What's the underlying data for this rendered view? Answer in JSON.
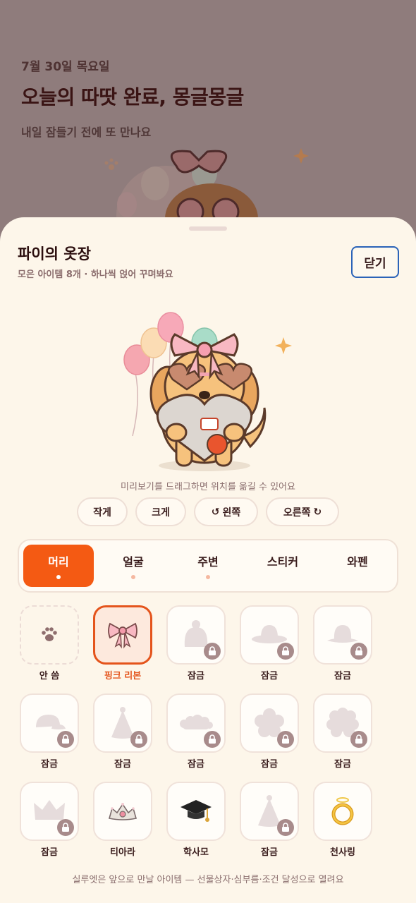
{
  "background": {
    "date": "7월 30일 목요일",
    "title": "오늘의 따땃 완료, 몽글몽글",
    "subtitle": "내일 잠들기 전에 또 만나요"
  },
  "sheet": {
    "title": "파이의 옷장",
    "subtitle": "모은 아이템 8개 · 하나씩 얹어 꾸며봐요",
    "close_label": "닫기",
    "drag_hint": "미리보기를 드래그하면 위치를 옮길 수 있어요",
    "controls": {
      "smaller": "작게",
      "bigger": "크게",
      "left": "왼쪽",
      "right": "오른쪽"
    },
    "tabs": [
      {
        "label": "머리",
        "active": true
      },
      {
        "label": "얼굴",
        "active": false
      },
      {
        "label": "주변",
        "active": false
      },
      {
        "label": "스티커",
        "active": false
      },
      {
        "label": "와펜",
        "active": false
      }
    ],
    "items": [
      {
        "label": "안 씀",
        "state": "none",
        "icon": "paw-icon"
      },
      {
        "label": "핑크 리본",
        "state": "selected",
        "icon": "pink-bow-icon"
      },
      {
        "label": "잠금",
        "state": "locked",
        "icon": "beanie-silhouette-icon"
      },
      {
        "label": "잠금",
        "state": "locked",
        "icon": "sun-hat-silhouette-icon"
      },
      {
        "label": "잠금",
        "state": "locked",
        "icon": "bucket-hat-silhouette-icon"
      },
      {
        "label": "잠금",
        "state": "locked",
        "icon": "cap-silhouette-icon"
      },
      {
        "label": "잠금",
        "state": "locked",
        "icon": "party-hat-silhouette-icon"
      },
      {
        "label": "잠금",
        "state": "locked",
        "icon": "cloud-headband-silhouette-icon"
      },
      {
        "label": "잠금",
        "state": "locked",
        "icon": "flower-silhouette-icon"
      },
      {
        "label": "잠금",
        "state": "locked",
        "icon": "curly-wig-silhouette-icon"
      },
      {
        "label": "잠금",
        "state": "locked",
        "icon": "crown-silhouette-icon"
      },
      {
        "label": "티아라",
        "state": "owned",
        "icon": "tiara-icon"
      },
      {
        "label": "학사모",
        "state": "owned",
        "icon": "graduation-cap-icon"
      },
      {
        "label": "잠금",
        "state": "locked",
        "icon": "party-hat-silhouette-icon"
      },
      {
        "label": "천사링",
        "state": "owned",
        "icon": "halo-icon"
      }
    ],
    "footnote": "실루엣은 앞으로 만날 아이템 — 선물상자·심부름·조건 달성으로 열려요"
  },
  "colors": {
    "accent": "#f45a13",
    "sheet_bg": "#fdf6ea",
    "scrim": "#8f7c7c",
    "close_border": "#2b63b8"
  }
}
